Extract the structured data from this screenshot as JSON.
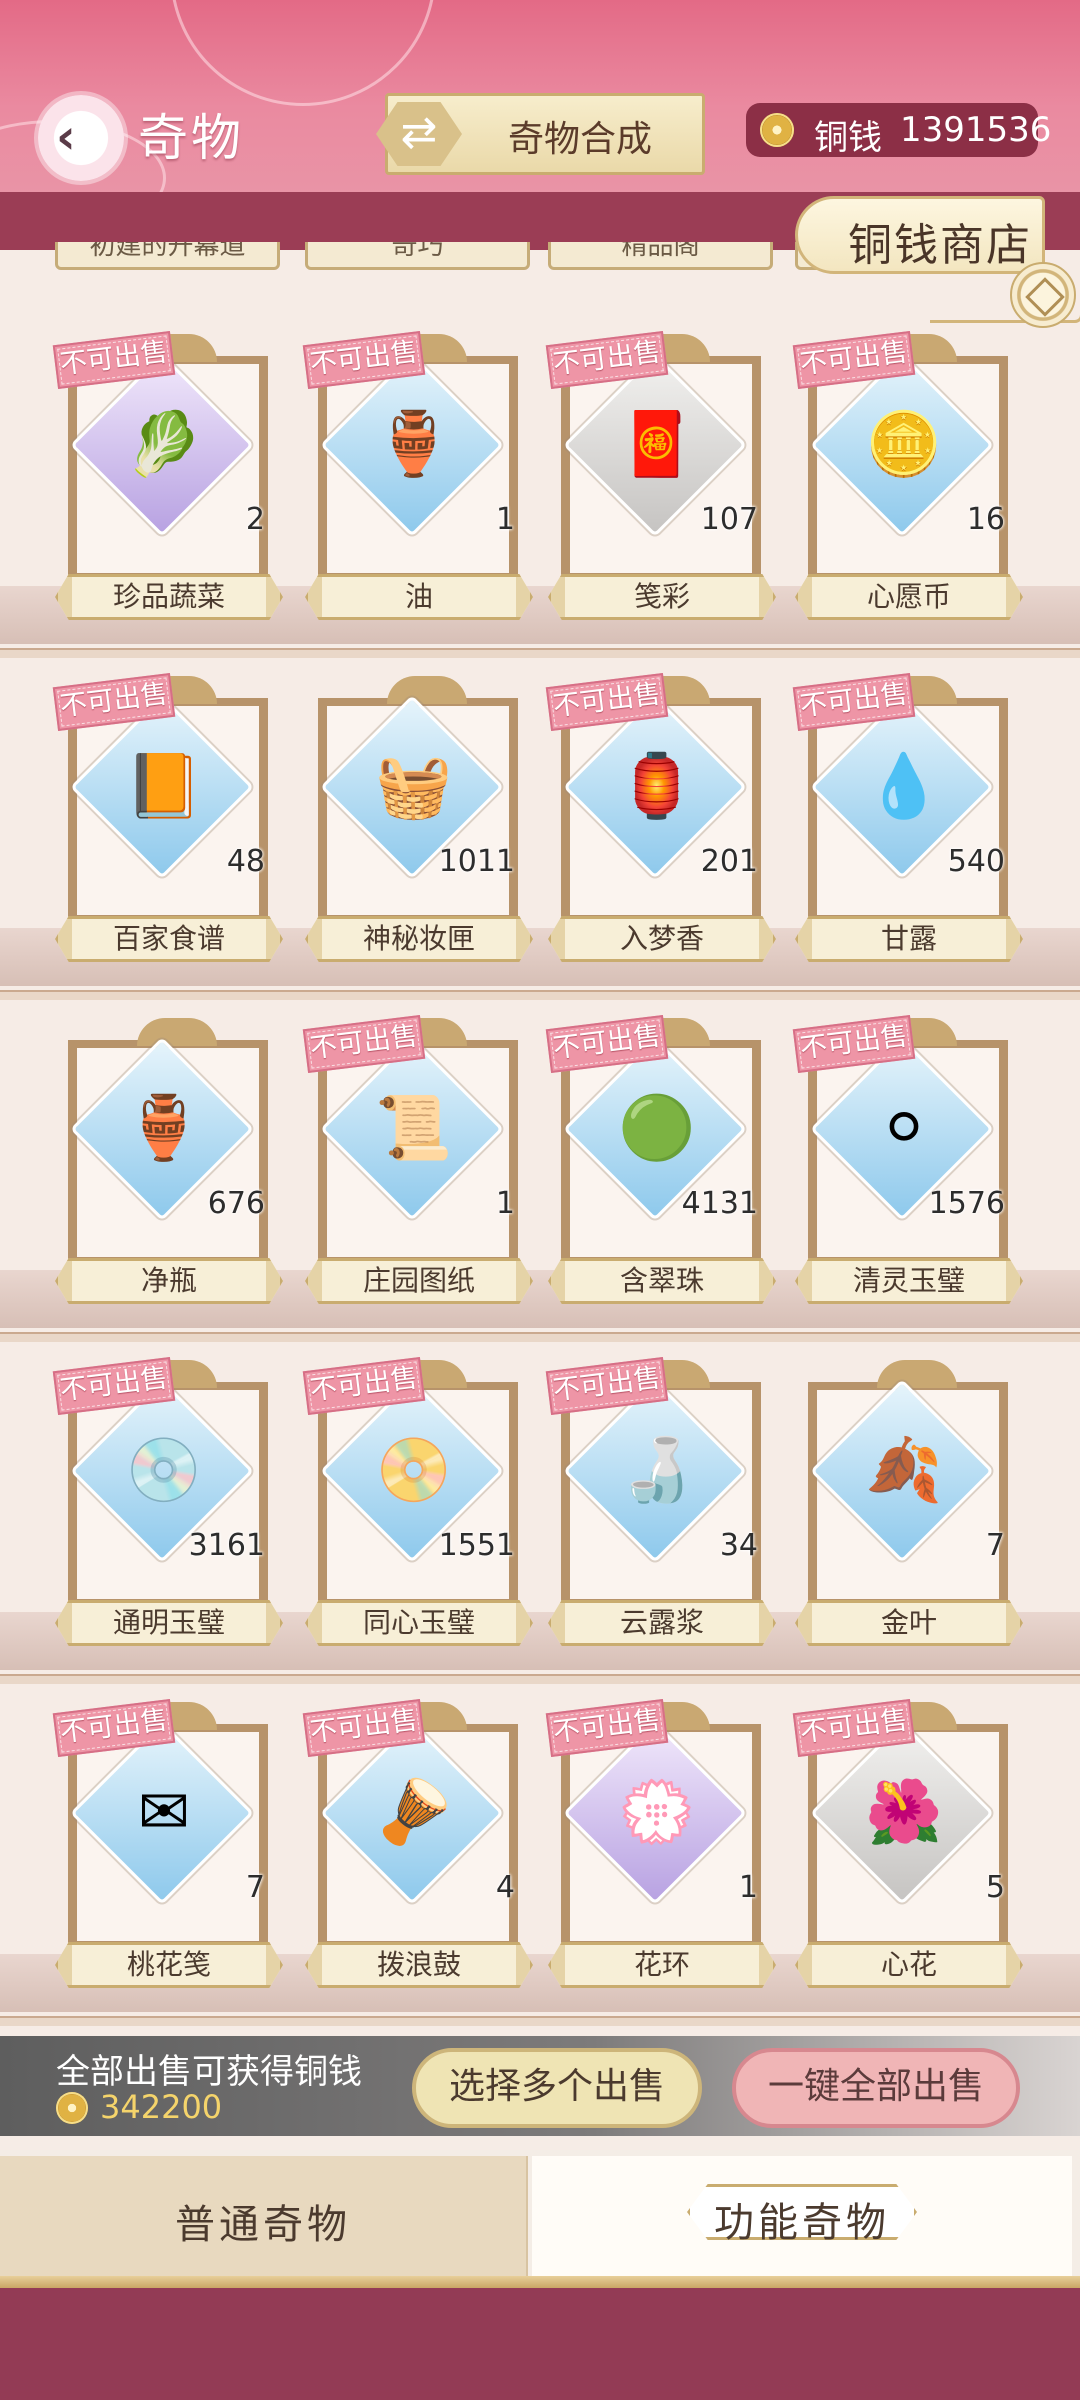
{
  "header": {
    "title": "奇物",
    "synth_label": "奇物合成",
    "currency_label": "铜钱",
    "currency_value": "1391536"
  },
  "subcategories": [
    "初建的开幕道",
    "奇巧",
    "精品阁",
    ""
  ],
  "shop_label": "铜钱商店",
  "items": [
    {
      "name": "珍品蔬菜",
      "count": "2",
      "badge": "不可出售",
      "quality": "purple",
      "icon": "cabbage-icon",
      "glyph": "🥬"
    },
    {
      "name": "油",
      "count": "1",
      "badge": "不可出售",
      "quality": "blue",
      "icon": "oil-jar-icon",
      "glyph": "🏺"
    },
    {
      "name": "笺彩",
      "count": "107",
      "badge": "不可出售",
      "quality": "grey",
      "icon": "colored-paper-icon",
      "glyph": "🧧"
    },
    {
      "name": "心愿币",
      "count": "16",
      "badge": "不可出售",
      "quality": "blue",
      "icon": "wish-coin-icon",
      "glyph": "🪙"
    },
    {
      "name": "百家食谱",
      "count": "48",
      "badge": "不可出售",
      "quality": "blue",
      "icon": "recipe-book-icon",
      "glyph": "📙"
    },
    {
      "name": "神秘妆匣",
      "count": "1011",
      "badge": "",
      "quality": "blue",
      "icon": "makeup-box-icon",
      "glyph": "🧺"
    },
    {
      "name": "入梦香",
      "count": "201",
      "badge": "不可出售",
      "quality": "blue",
      "icon": "incense-burner-icon",
      "glyph": "🏮"
    },
    {
      "name": "甘露",
      "count": "540",
      "badge": "不可出售",
      "quality": "blue",
      "icon": "dew-drop-icon",
      "glyph": "💧"
    },
    {
      "name": "净瓶",
      "count": "676",
      "badge": "",
      "quality": "blue",
      "icon": "vase-icon",
      "glyph": "🏺"
    },
    {
      "name": "庄园图纸",
      "count": "1",
      "badge": "不可出售",
      "quality": "blue",
      "icon": "blueprint-scroll-icon",
      "glyph": "📜"
    },
    {
      "name": "含翠珠",
      "count": "4131",
      "badge": "不可出售",
      "quality": "blue",
      "icon": "jade-pearl-icon",
      "glyph": "🟢"
    },
    {
      "name": "清灵玉璧",
      "count": "1576",
      "badge": "不可出售",
      "quality": "blue",
      "icon": "jade-disc-icon",
      "glyph": "⚪"
    },
    {
      "name": "通明玉璧",
      "count": "3161",
      "badge": "不可出售",
      "quality": "blue",
      "icon": "jade-disc-ornate-icon",
      "glyph": "💿"
    },
    {
      "name": "同心玉璧",
      "count": "1551",
      "badge": "不可出售",
      "quality": "blue",
      "icon": "jade-disc-gold-icon",
      "glyph": "📀"
    },
    {
      "name": "云露浆",
      "count": "34",
      "badge": "不可出售",
      "quality": "blue",
      "icon": "purple-bottle-icon",
      "glyph": "🍶"
    },
    {
      "name": "金叶",
      "count": "7",
      "badge": "",
      "quality": "blue",
      "icon": "ginkgo-leaf-icon",
      "glyph": "🍂"
    },
    {
      "name": "桃花笺",
      "count": "7",
      "badge": "不可出售",
      "quality": "blue",
      "icon": "peach-letter-icon",
      "glyph": "✉"
    },
    {
      "name": "拨浪鼓",
      "count": "4",
      "badge": "不可出售",
      "quality": "blue",
      "icon": "rattle-drum-icon",
      "glyph": "🪘"
    },
    {
      "name": "花环",
      "count": "1",
      "badge": "不可出售",
      "quality": "purple",
      "icon": "flower-wreath-icon",
      "glyph": "💮"
    },
    {
      "name": "心花",
      "count": "5",
      "badge": "不可出售",
      "quality": "grey",
      "icon": "heart-flower-icon",
      "glyph": "🌺"
    }
  ],
  "sell": {
    "label": "全部出售可获得铜钱",
    "amount": "342200",
    "multi_label": "选择多个出售",
    "all_label": "一键全部出售"
  },
  "tabs": {
    "normal": "普通奇物",
    "functional": "功能奇物"
  },
  "colors": {
    "header": "#e36a86",
    "badge": "#ee95a6",
    "frame": "#b7936a",
    "bottom_bar": "#933b55"
  }
}
